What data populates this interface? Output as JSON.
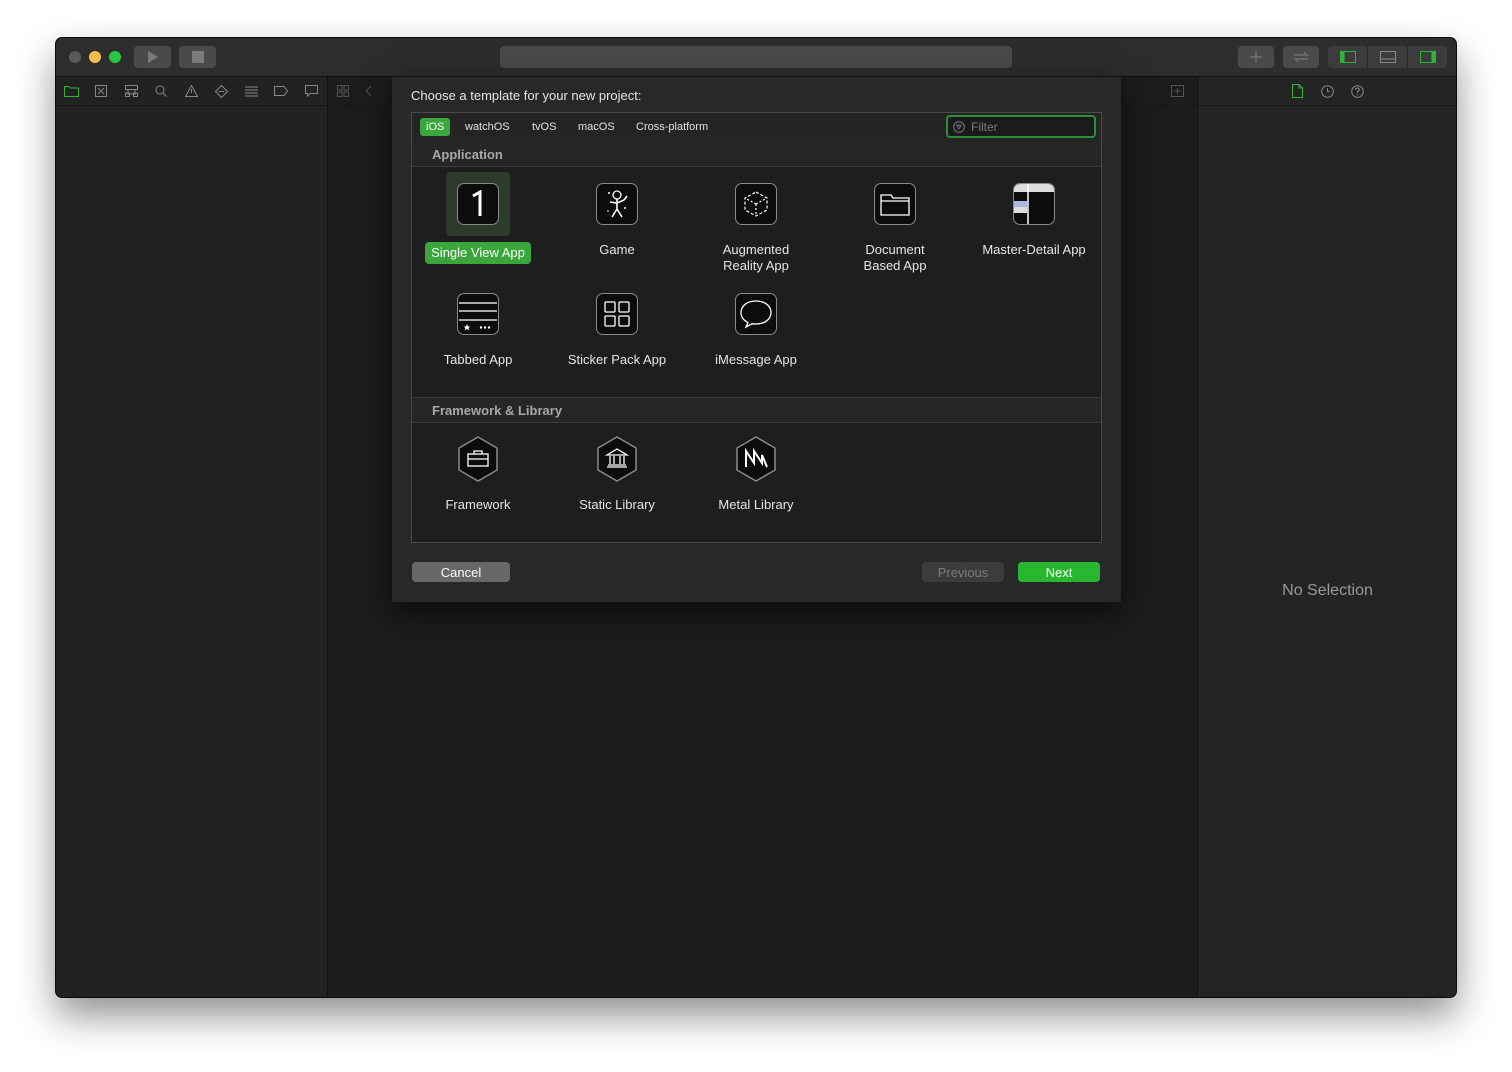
{
  "sheet": {
    "title": "Choose a template for your new project:",
    "tabs": [
      "iOS",
      "watchOS",
      "tvOS",
      "macOS",
      "Cross-platform"
    ],
    "active_tab": "iOS",
    "filter_placeholder": "Filter",
    "sections": [
      {
        "title": "Application",
        "items": [
          {
            "label": "Single View App",
            "icon": "single-view-icon",
            "selected": true
          },
          {
            "label": "Game",
            "icon": "game-icon"
          },
          {
            "label": "Augmented Reality App",
            "icon": "ar-icon"
          },
          {
            "label": "Document Based App",
            "icon": "folder-icon"
          },
          {
            "label": "Master-Detail App",
            "icon": "master-detail-icon"
          },
          {
            "label": "Tabbed App",
            "icon": "tabbed-icon"
          },
          {
            "label": "Sticker Pack App",
            "icon": "sticker-grid-icon"
          },
          {
            "label": "iMessage App",
            "icon": "message-bubble-icon"
          }
        ]
      },
      {
        "title": "Framework & Library",
        "items": [
          {
            "label": "Framework",
            "icon": "framework-icon"
          },
          {
            "label": "Static Library",
            "icon": "static-library-icon"
          },
          {
            "label": "Metal Library",
            "icon": "metal-library-icon"
          }
        ]
      }
    ],
    "buttons": {
      "cancel": "Cancel",
      "previous": "Previous",
      "next": "Next"
    }
  },
  "inspector": {
    "empty_text": "No Selection"
  },
  "colors": {
    "accent": "#3aa63c",
    "next_button": "#28b82f",
    "window_bg": "#1e1e1e"
  }
}
